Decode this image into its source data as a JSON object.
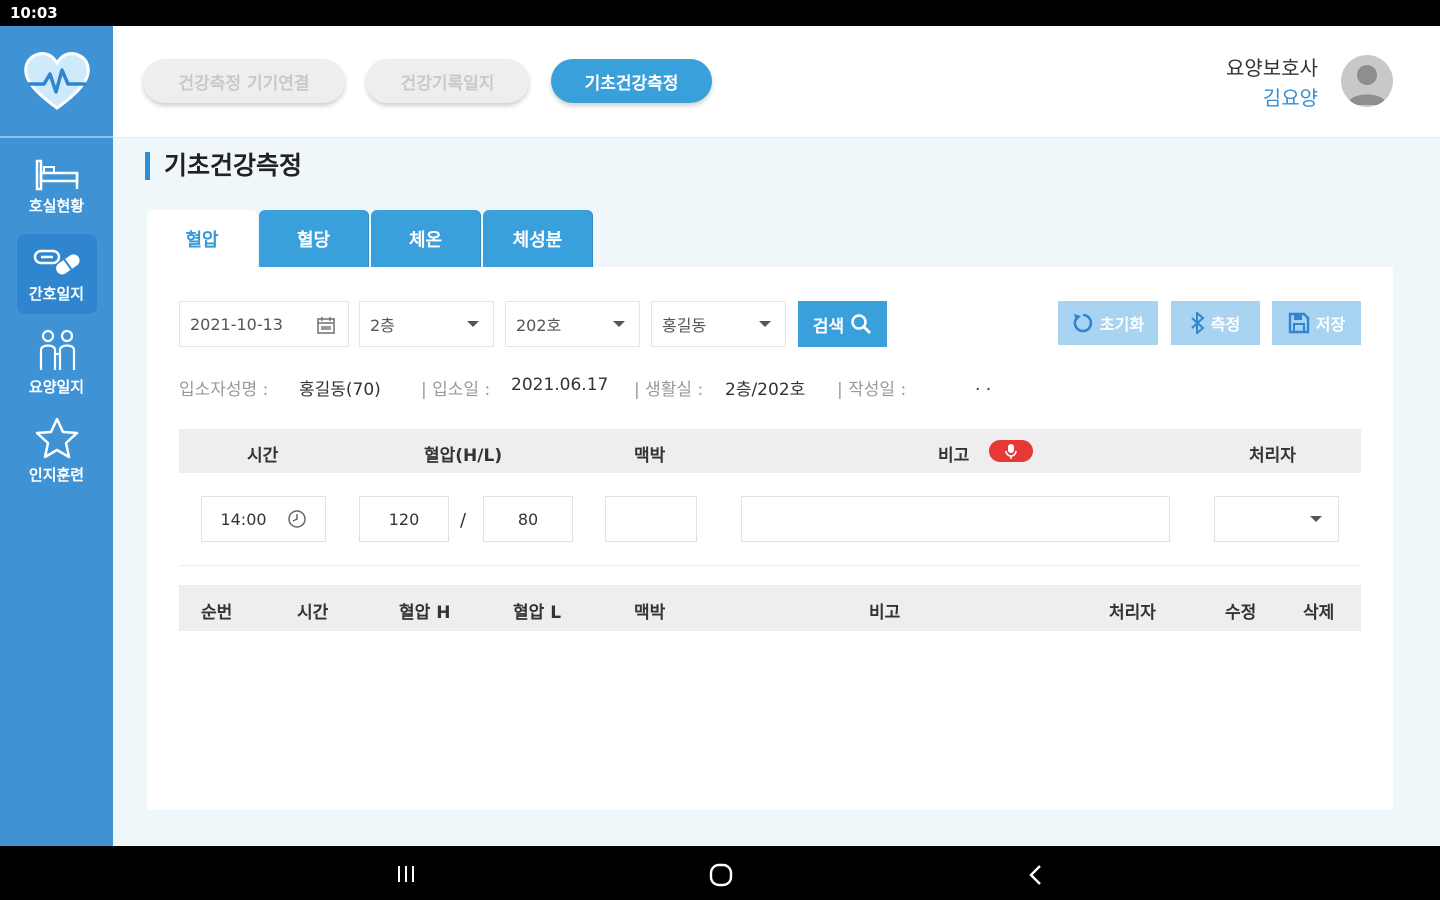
{
  "status_bar": {
    "time": "10:03"
  },
  "sidebar": {
    "items": [
      {
        "label": "호실현황",
        "icon": "bed-icon"
      },
      {
        "label": "간호일지",
        "icon": "pills-icon"
      },
      {
        "label": "요양일지",
        "icon": "caregiver-icon"
      },
      {
        "label": "인지훈련",
        "icon": "star-icon"
      }
    ]
  },
  "topnav": {
    "buttons": [
      "건강측정 기기연결",
      "건강기록일지",
      "기초건강측정"
    ],
    "user_role": "요양보호사",
    "user_name": "김요양"
  },
  "page_title": "기초건강측정",
  "tabs": [
    "혈압",
    "혈당",
    "체온",
    "체성분"
  ],
  "filters": {
    "date": "2021-10-13",
    "floor": "2층",
    "room": "202호",
    "resident": "홍길동",
    "search_label": "검색"
  },
  "actions": {
    "reset": "초기화",
    "measure": "측정",
    "save": "저장"
  },
  "resident_info": {
    "name_label": "입소자성명 :",
    "name_value": "홍길동(70)",
    "admission_label": "| 입소일 :",
    "admission_value": "2021.06.17",
    "room_label": "| 생활실 :",
    "room_value": "2층/202호",
    "written_label": "| 작성일 :",
    "written_value": ". ."
  },
  "entry_table": {
    "headers": [
      "시간",
      "혈압(H/L)",
      "맥박",
      "비고",
      "처리자"
    ],
    "time": "14:00",
    "bp_high": "120",
    "bp_low": "80",
    "slash": "/"
  },
  "records_table": {
    "headers": [
      "순번",
      "시간",
      "혈압 H",
      "혈압 L",
      "맥박",
      "비고",
      "처리자",
      "수정",
      "삭제"
    ]
  },
  "colors": {
    "accent": "#3aa0dc",
    "sidebar": "#3f93d4"
  }
}
